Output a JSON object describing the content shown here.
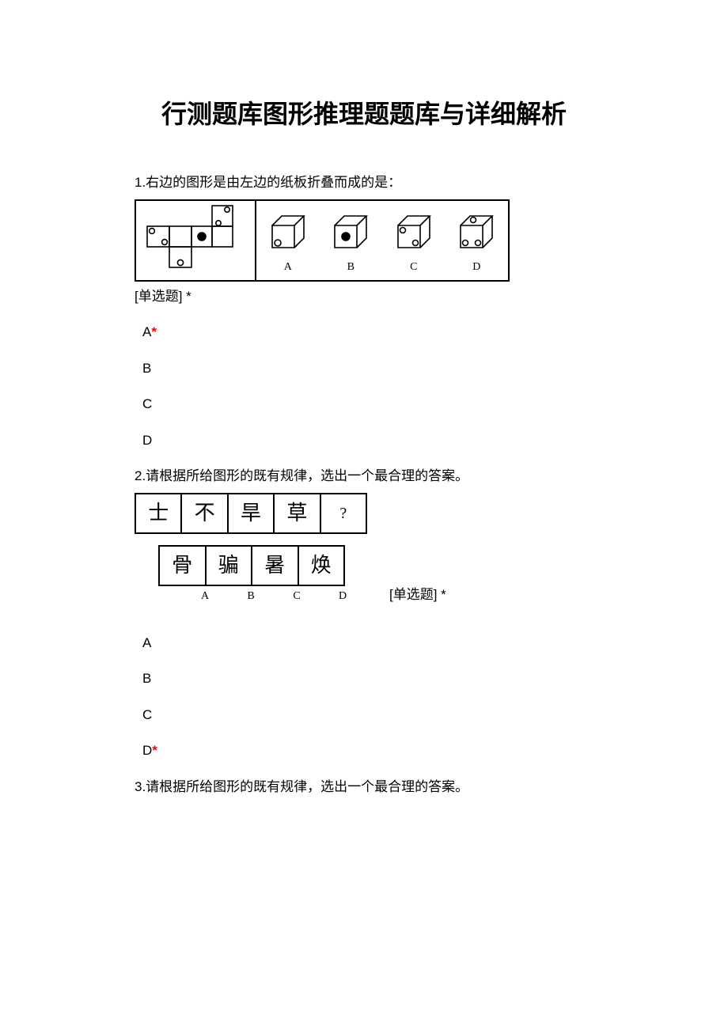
{
  "title": "行测题库图形推理题题库与详细解析",
  "questions": [
    {
      "number": "1",
      "text": "1.右边的图形是由左边的纸板折叠而成的是：",
      "type_tag": "[单选题] *",
      "figure": {
        "kind": "cube-net",
        "answer_labels": [
          "A",
          "B",
          "C",
          "D"
        ]
      },
      "options": [
        {
          "label": "A",
          "correct": true
        },
        {
          "label": "B",
          "correct": false
        },
        {
          "label": "C",
          "correct": false
        },
        {
          "label": "D",
          "correct": false
        }
      ]
    },
    {
      "number": "2",
      "text": "2.请根据所给图形的既有规律，选出一个最合理的答案。",
      "type_tag": "[单选题] *",
      "figure": {
        "kind": "char-grid",
        "row1": [
          "士",
          "不",
          "旱",
          "草",
          "?"
        ],
        "row2": [
          "骨",
          "骗",
          "暑",
          "焕"
        ],
        "row2_labels": [
          "A",
          "B",
          "C",
          "D"
        ]
      },
      "options": [
        {
          "label": "A",
          "correct": false
        },
        {
          "label": "B",
          "correct": false
        },
        {
          "label": "C",
          "correct": false
        },
        {
          "label": "D",
          "correct": true
        }
      ]
    },
    {
      "number": "3",
      "text": "3.请根据所给图形的既有规律，选出一个最合理的答案。",
      "type_tag": "",
      "figure": null,
      "options": []
    }
  ]
}
